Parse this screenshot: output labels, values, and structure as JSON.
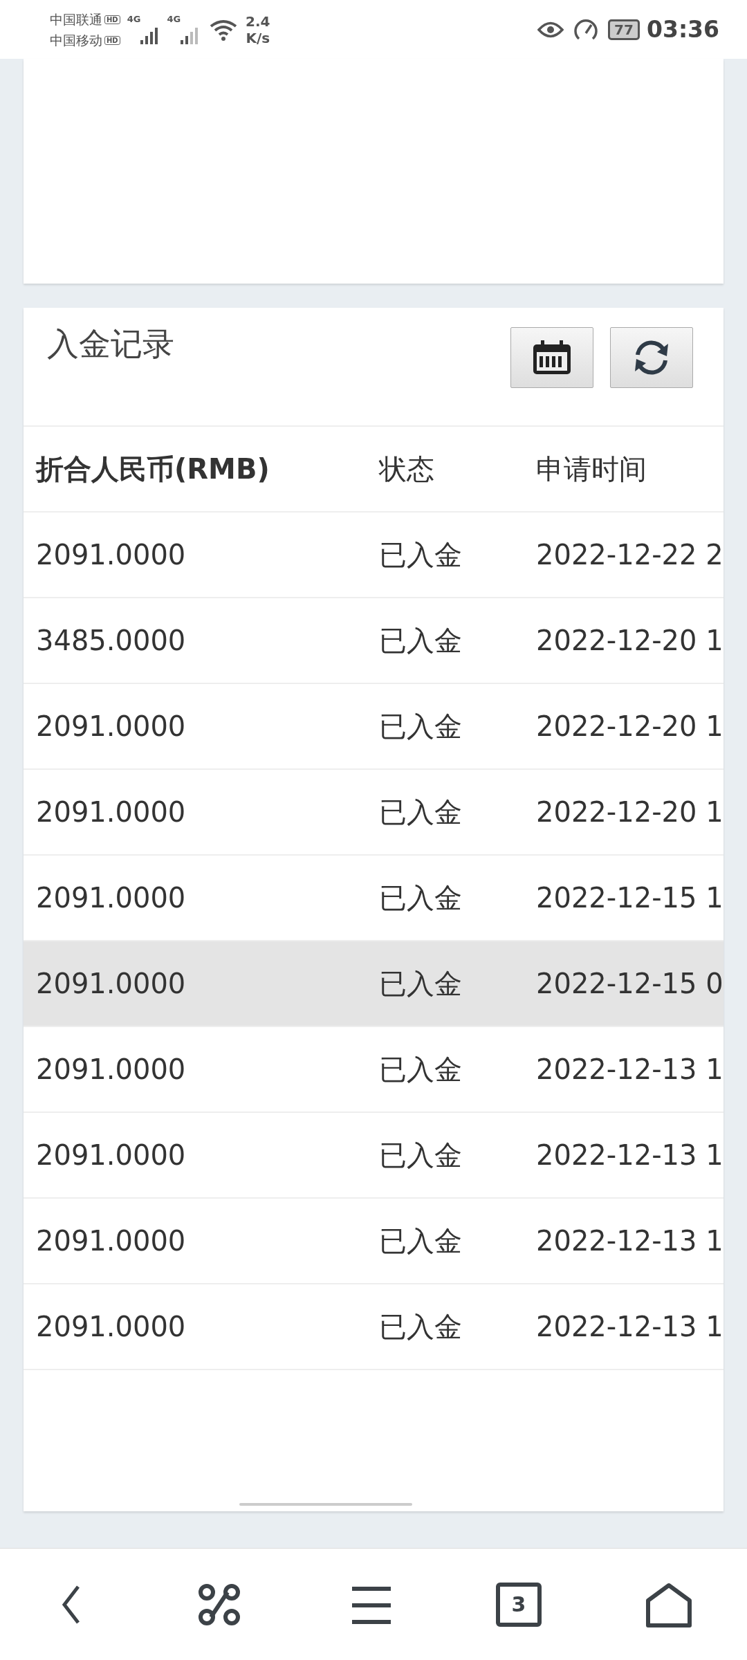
{
  "status_bar": {
    "carriers": [
      {
        "name": "中国联通",
        "badge": "HD",
        "network": "4G"
      },
      {
        "name": "中国移动",
        "badge": "HD",
        "network": "4G"
      }
    ],
    "speed": [
      "2.4",
      "K/s"
    ],
    "battery": "77",
    "time": "03:36"
  },
  "section": {
    "title": "入金记录"
  },
  "table": {
    "columns": [
      "折合人民币(RMB)",
      "状态",
      "申请时间"
    ],
    "rows": [
      {
        "cells": [
          "2091.0000",
          "已入金",
          "2022-12-22 2"
        ],
        "selected": false
      },
      {
        "cells": [
          "3485.0000",
          "已入金",
          "2022-12-20 1"
        ],
        "selected": false
      },
      {
        "cells": [
          "2091.0000",
          "已入金",
          "2022-12-20 1"
        ],
        "selected": false
      },
      {
        "cells": [
          "2091.0000",
          "已入金",
          "2022-12-20 1"
        ],
        "selected": false
      },
      {
        "cells": [
          "2091.0000",
          "已入金",
          "2022-12-15 1"
        ],
        "selected": false
      },
      {
        "cells": [
          "2091.0000",
          "已入金",
          "2022-12-15 0"
        ],
        "selected": true
      },
      {
        "cells": [
          "2091.0000",
          "已入金",
          "2022-12-13 1"
        ],
        "selected": false
      },
      {
        "cells": [
          "2091.0000",
          "已入金",
          "2022-12-13 1"
        ],
        "selected": false
      },
      {
        "cells": [
          "2091.0000",
          "已入金",
          "2022-12-13 1"
        ],
        "selected": false
      },
      {
        "cells": [
          "2091.0000",
          "已入金",
          "2022-12-13 1"
        ],
        "selected": false
      }
    ]
  },
  "nav_bar": {
    "tab_count": "3"
  }
}
